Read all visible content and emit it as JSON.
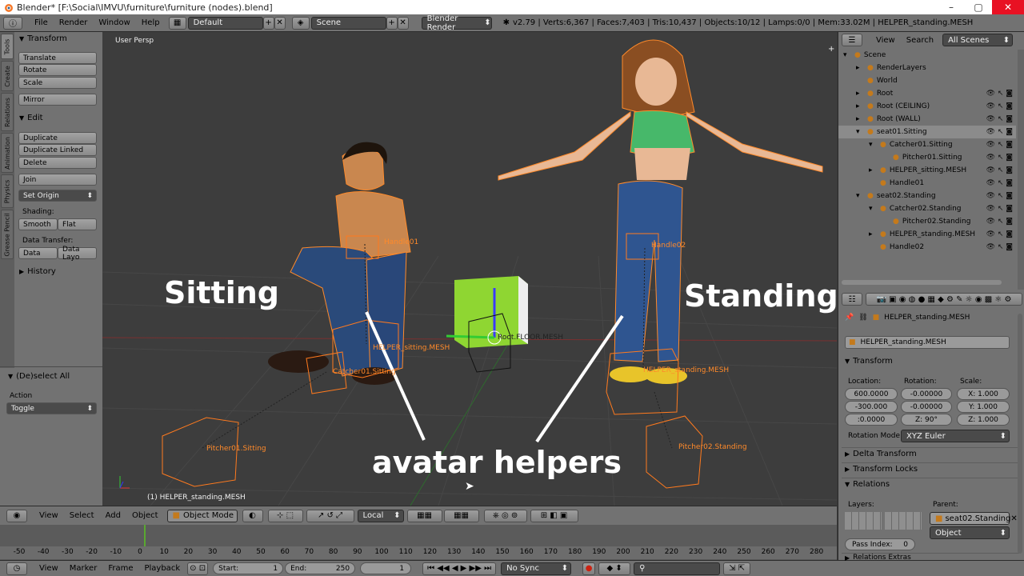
{
  "window": {
    "title": "Blender* [F:\\Social\\IMVU\\furniture\\furniture (nodes).blend]"
  },
  "info": {
    "menus": [
      "File",
      "Render",
      "Window",
      "Help"
    ],
    "layout": "Default",
    "scene": "Scene",
    "engine": "Blender Render",
    "stats": "v2.79 | Verts:6,367 | Faces:7,403 | Tris:10,437 | Objects:10/12 | Lamps:0/0 | Mem:33.02M | HELPER_standing.MESH"
  },
  "toolshelf": {
    "tabs": [
      "Tools",
      "Create",
      "Relations",
      "Animation",
      "Physics",
      "Grease Pencil"
    ],
    "transform_title": "Transform",
    "transform_buttons": [
      "Translate",
      "Rotate",
      "Scale",
      "Mirror"
    ],
    "edit_title": "Edit",
    "edit_buttons": [
      "Duplicate",
      "Duplicate Linked",
      "Delete",
      "Join"
    ],
    "set_origin": "Set Origin",
    "shading_label": "Shading:",
    "shading": [
      "Smooth",
      "Flat"
    ],
    "data_transfer_label": "Data Transfer:",
    "data_transfer": [
      "Data",
      "Data Layo"
    ],
    "history": "History",
    "operator_title": "(De)select All",
    "action_label": "Action",
    "action_value": "Toggle"
  },
  "viewport": {
    "view_name": "User Persp",
    "selected_info": "(1) HELPER_standing.MESH",
    "overlay": {
      "sitting": "Sitting",
      "standing": "Standing",
      "helpers": "avatar helpers"
    },
    "labels": {
      "handle01": "Handle01",
      "helper_sitting": "HELPER_sitting.MESH",
      "catcher01": "Catcher01.Sitting",
      "pitcher01": "Pitcher01.Sitting",
      "floor": "Root.FLOOR.MESH",
      "handle02": "Handle02",
      "helper_standing": "HELPER_standing.MESH",
      "pitcher02": "Pitcher02.Standing"
    }
  },
  "view3d_header": {
    "menus": [
      "View",
      "Select",
      "Add",
      "Object"
    ],
    "mode": "Object Mode",
    "orientation": "Local"
  },
  "timeline": {
    "ticks": [
      "-50",
      "-40",
      "-30",
      "-20",
      "-10",
      "0",
      "10",
      "20",
      "30",
      "40",
      "50",
      "60",
      "70",
      "80",
      "90",
      "100",
      "110",
      "120",
      "130",
      "140",
      "150",
      "160",
      "170",
      "180",
      "190",
      "200",
      "210",
      "220",
      "230",
      "240",
      "250",
      "260",
      "270",
      "280"
    ],
    "menus": [
      "View",
      "Marker",
      "Frame",
      "Playback"
    ],
    "start_label": "Start:",
    "start": "1",
    "end_label": "End:",
    "end": "250",
    "current": "1",
    "sync": "No Sync"
  },
  "outliner": {
    "header": [
      "View",
      "Search"
    ],
    "filter": "All Scenes",
    "rows": [
      {
        "label": "Scene",
        "indent": 0,
        "expander": "▾"
      },
      {
        "label": "RenderLayers",
        "indent": 1,
        "expander": "▸"
      },
      {
        "label": "World",
        "indent": 1,
        "expander": ""
      },
      {
        "label": "Root",
        "indent": 1,
        "expander": "▸"
      },
      {
        "label": "Root (CEILING)",
        "indent": 1,
        "expander": "▸"
      },
      {
        "label": "Root (WALL)",
        "indent": 1,
        "expander": "▸"
      },
      {
        "label": "seat01.Sitting",
        "indent": 1,
        "expander": "▾"
      },
      {
        "label": "Catcher01.Sitting",
        "indent": 2,
        "expander": "▾"
      },
      {
        "label": "Pitcher01.Sitting",
        "indent": 3,
        "expander": ""
      },
      {
        "label": "HELPER_sitting.MESH",
        "indent": 2,
        "expander": "▸"
      },
      {
        "label": "Handle01",
        "indent": 2,
        "expander": ""
      },
      {
        "label": "seat02.Standing",
        "indent": 1,
        "expander": "▾"
      },
      {
        "label": "Catcher02.Standing",
        "indent": 2,
        "expander": "▾"
      },
      {
        "label": "Pitcher02.Standing",
        "indent": 3,
        "expander": ""
      },
      {
        "label": "HELPER_standing.MESH",
        "indent": 2,
        "expander": "▸"
      },
      {
        "label": "Handle02",
        "indent": 2,
        "expander": ""
      }
    ]
  },
  "properties": {
    "breadcrumb": "HELPER_standing.MESH",
    "object_name": "HELPER_standing.MESH",
    "transform_title": "Transform",
    "location_label": "Location:",
    "rotation_label": "Rotation:",
    "scale_label": "Scale:",
    "location": [
      "600.0000",
      "-300.000",
      ":0.0000"
    ],
    "rotation": [
      "-0.00000",
      "-0.00000",
      "Z:     90°"
    ],
    "scale": [
      "X:  1.000",
      "Y:  1.000",
      "Z:  1.000"
    ],
    "rotation_mode_label": "Rotation Mode:",
    "rotation_mode": "XYZ Euler",
    "delta_transform": "Delta Transform",
    "transform_locks": "Transform Locks",
    "relations": "Relations",
    "layers_label": "Layers:",
    "parent_label": "Parent:",
    "parent": "seat02.Standing",
    "parent_type": "Object",
    "pass_index_label": "Pass Index:",
    "pass_index": "0",
    "relations_extras": "Relations Extras"
  }
}
